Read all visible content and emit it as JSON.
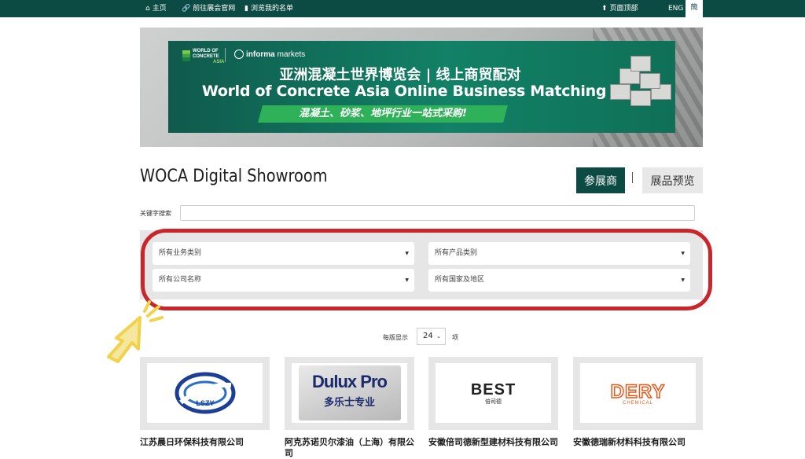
{
  "topbar": {
    "home": "主页",
    "official_site": "前往展会官网",
    "my_list": "浏览我的名单",
    "back_to_top": "页面顶部",
    "lang_en": "ENG",
    "lang_cn": "簡"
  },
  "banner": {
    "logo_woc_line1": "WORLD OF",
    "logo_woc_line2": "CONCRETE",
    "logo_woc_line3": "ASIA",
    "logo_informa_a": "informa",
    "logo_informa_b": "markets",
    "title_cn": "亚洲混凝土世界博览会 | 线上商贸配对",
    "title_en": "World of Concrete Asia Online Business Matching",
    "tagline": "混凝土、砂浆、地坪行业一站式采购!"
  },
  "page": {
    "title": "WOCA Digital Showroom",
    "tab_exhibitors": "参展商",
    "tab_divider": "|",
    "tab_products": "展品预览"
  },
  "search": {
    "label": "关键字搜索",
    "value": "",
    "placeholder": ""
  },
  "filters": {
    "business_category": "所有业务类别",
    "product_category": "所有产品类别",
    "company_name": "所有公司名称",
    "country_region": "所有国家及地区"
  },
  "pagination": {
    "label": "每版显示",
    "page_size": "24",
    "unit": "项"
  },
  "cards": [
    {
      "name": "江苏晨日环保科技有限公司",
      "logo_text": "LSZY"
    },
    {
      "name": "阿克苏诺贝尔漆油（上海）有限公司",
      "logo_text_1": "Dulux Pro",
      "logo_text_2": "多乐士专业"
    },
    {
      "name": "安徽倍司德新型建材科技有限公司",
      "logo_text_1": "BEST",
      "logo_text_2": "倍司德"
    },
    {
      "name": "安徽德瑞新材料科技有限公司",
      "logo_text_1": "DERY",
      "logo_text_2": "CHEMICAL"
    }
  ],
  "colors": {
    "brand_dark_green": "#0c4a44",
    "highlight_red": "#c9262b",
    "pointer_yellow": "#f2d24b"
  },
  "icons": [
    "home-icon",
    "link-icon",
    "bookmark-icon",
    "arrow-up-icon",
    "caret-down-icon",
    "chevron-down-icon",
    "pointer-arrow-icon"
  ]
}
